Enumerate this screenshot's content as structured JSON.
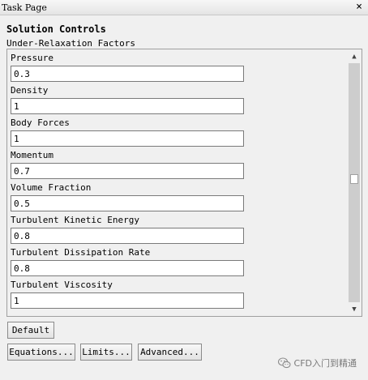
{
  "window": {
    "title": "Task Page",
    "close_symbol": "×"
  },
  "heading": "Solution Controls",
  "group_label": "Under-Relaxation Factors",
  "fields": [
    {
      "label": "Pressure",
      "value": "0.3"
    },
    {
      "label": "Density",
      "value": "1"
    },
    {
      "label": "Body Forces",
      "value": "1"
    },
    {
      "label": "Momentum",
      "value": "0.7"
    },
    {
      "label": "Volume Fraction",
      "value": "0.5"
    },
    {
      "label": "Turbulent Kinetic Energy",
      "value": "0.8"
    },
    {
      "label": "Turbulent Dissipation Rate",
      "value": "0.8"
    },
    {
      "label": "Turbulent Viscosity",
      "value": "1"
    }
  ],
  "scrollbar": {
    "up_symbol": "▲",
    "down_symbol": "▼",
    "position_fraction": 0.47
  },
  "buttons": {
    "default_label": "Default",
    "equations_label": "Equations...",
    "limits_label": "Limits...",
    "advanced_label": "Advanced..."
  },
  "watermark": {
    "text": "CFD入门到精通",
    "icon": "wechat-icon"
  }
}
